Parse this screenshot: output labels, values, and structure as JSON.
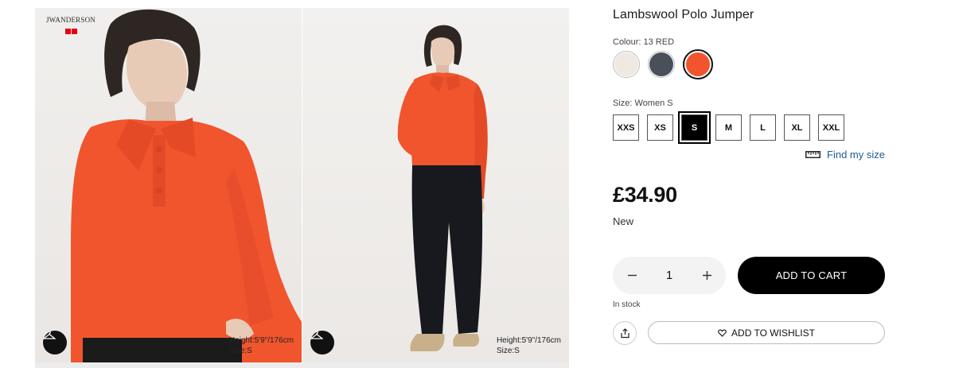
{
  "gallery": {
    "brand_name": "JWANDERSON",
    "left_photo": {
      "model_height": "Height:5'9\"/176cm",
      "model_size": "Size:S"
    },
    "right_photo": {
      "model_height": "Height:5'9\"/176cm",
      "model_size": "Size:S"
    }
  },
  "product": {
    "title": "Lambswool Polo Jumper",
    "colour_label": "Colour: 13 RED",
    "colours": [
      {
        "name": "off-white",
        "hex": "#efe9e1",
        "selected": false
      },
      {
        "name": "navy",
        "hex": "#4a4f5a",
        "selected": false
      },
      {
        "name": "red",
        "hex": "#f0552e",
        "selected": true
      }
    ],
    "size_label": "Size: Women S",
    "sizes": [
      "XXS",
      "XS",
      "S",
      "M",
      "L",
      "XL",
      "XXL"
    ],
    "selected_size": "S",
    "find_size_label": "Find my size",
    "price": "£34.90",
    "flag": "New",
    "quantity": "1",
    "add_to_cart_label": "ADD TO CART",
    "stock_status": "In stock",
    "wishlist_label": "ADD TO WISHLIST"
  },
  "colors": {
    "accent_link": "#1f5a96",
    "product_orange": "#f0552e",
    "button_black": "#000000"
  },
  "icons": [
    "hanger-icon",
    "ruler-icon",
    "minus-icon",
    "plus-icon",
    "share-icon",
    "heart-icon"
  ]
}
